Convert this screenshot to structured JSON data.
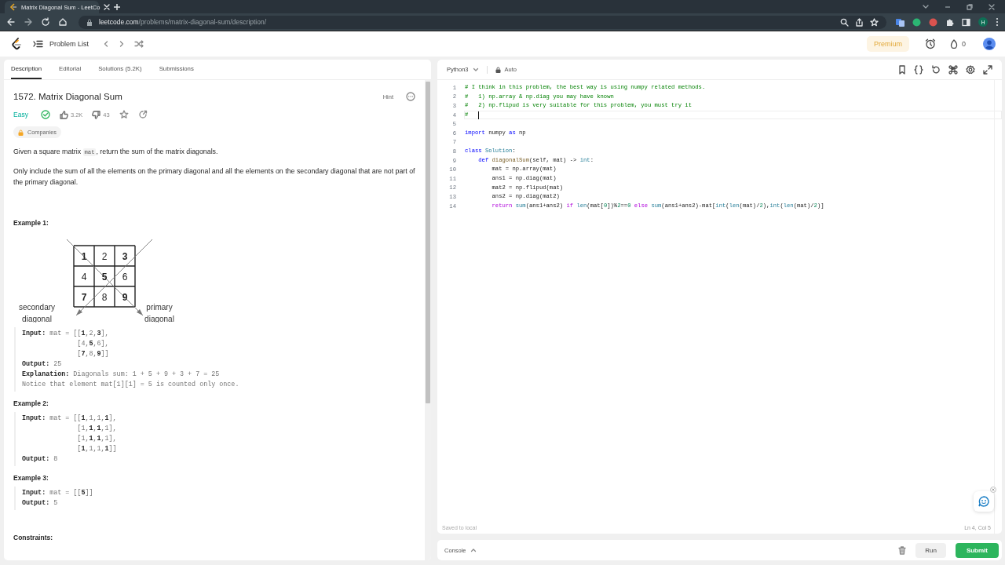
{
  "browser": {
    "tab_title": "Matrix Diagonal Sum - LeetCo",
    "url_host": "leetcode.com",
    "url_path": "/problems/matrix-diagonal-sum/description/",
    "profile_initial": "H"
  },
  "nav": {
    "problem_list": "Problem List",
    "premium": "Premium",
    "streak": "0"
  },
  "description": {
    "tabs": [
      {
        "label": "Description",
        "selected": true
      },
      {
        "label": "Editorial",
        "selected": false
      },
      {
        "label": "Solutions (5.2K)",
        "selected": false
      },
      {
        "label": "Submissions",
        "selected": false
      }
    ],
    "title": "1572. Matrix Diagonal Sum",
    "hint": "Hint",
    "difficulty": "Easy",
    "solved": true,
    "likes": "3.2K",
    "dislikes": "43",
    "companies": "Companies",
    "paragraphs": [
      [
        {
          "text": "Given a square matrix "
        },
        {
          "text": "mat",
          "kind": "code"
        },
        {
          "text": ", return the sum of the matrix diagonals."
        }
      ],
      [
        {
          "text": "Only include the sum of all the elements on the primary diagonal and all the elements on the secondary diagonal that are not part of the primary diagonal."
        }
      ]
    ],
    "examples": [
      {
        "heading": "Example 1:",
        "diagram": {
          "cells": [
            {
              "text": "1",
              "bold": true
            },
            {
              "text": "2",
              "bold": false
            },
            {
              "text": "3",
              "bold": true
            },
            {
              "text": "4",
              "bold": false
            },
            {
              "text": "5",
              "bold": true
            },
            {
              "text": "6",
              "bold": false
            },
            {
              "text": "7",
              "bold": true
            },
            {
              "text": "8",
              "bold": false
            },
            {
              "text": "9",
              "bold": true
            }
          ],
          "secondary_label": [
            "secondary",
            "diagonal"
          ],
          "primary_label": [
            "primary",
            "diagonal"
          ]
        },
        "lines": [
          "**Input:** mat = [[**1**,2,**3**],",
          "              [4,**5**,6],",
          "              [**7**,8,**9**]]",
          "**Output:** 25",
          "**Explanation:** Diagonals sum: 1 + 5 + 9 + 3 + 7 = 25",
          "Notice that element mat[1][1] = 5 is counted only once."
        ]
      },
      {
        "heading": "Example 2:",
        "lines": [
          "**Input:** mat = [[**1**,1,1,**1**],",
          "              [1,**1**,**1**,1],",
          "              [1,**1**,**1**,1],",
          "              [**1**,1,1,**1**]]",
          "**Output:** 8"
        ]
      },
      {
        "heading": "Example 3:",
        "lines": [
          "**Input:** mat = [[**5**]]",
          "**Output:** 5"
        ]
      }
    ],
    "constraints_heading": "Constraints:"
  },
  "editor": {
    "language": "Python3",
    "mode": "Auto",
    "lines": [
      {
        "no": "1",
        "current": false,
        "tokens": [
          {
            "t": "# I think in this problem, the best way is using numpy related methods.",
            "kind": "comment"
          }
        ]
      },
      {
        "no": "2",
        "current": false,
        "tokens": [
          {
            "t": "#   1) np.array & np.diag you may have known",
            "kind": "comment"
          }
        ]
      },
      {
        "no": "3",
        "current": false,
        "tokens": [
          {
            "t": "#   2) np.flipud is very suitable for this problem, you must try it",
            "kind": "comment"
          }
        ]
      },
      {
        "no": "4",
        "current": true,
        "tokens": [
          {
            "t": "#   ",
            "kind": "comment"
          }
        ]
      },
      {
        "no": "5",
        "current": false
      },
      {
        "no": "6",
        "current": false,
        "tokens": [
          {
            "t": "import",
            "kind": "keyword"
          },
          {
            "t": " numpy ",
            "kind": "plain"
          },
          {
            "t": "as",
            "kind": "keyword"
          },
          {
            "t": " np",
            "kind": "plain"
          }
        ]
      },
      {
        "no": "7",
        "current": false
      },
      {
        "no": "8",
        "current": false,
        "tokens": [
          {
            "t": "class",
            "kind": "keyword"
          },
          {
            "t": " Solution",
            "kind": "class"
          },
          {
            "t": ":",
            "kind": "plain"
          }
        ]
      },
      {
        "no": "9",
        "current": false,
        "tokens": [
          {
            "t": "    def",
            "kind": "keyword"
          },
          {
            "t": " diagonalSum",
            "kind": "function"
          },
          {
            "t": "(self, mat) -> ",
            "kind": "plain"
          },
          {
            "t": "int",
            "kind": "builtin"
          },
          {
            "t": ":",
            "kind": "plain"
          }
        ]
      },
      {
        "no": "10",
        "current": false,
        "tokens": [
          {
            "t": "        mat = np.array(mat)",
            "kind": "plain"
          }
        ]
      },
      {
        "no": "11",
        "current": false,
        "tokens": [
          {
            "t": "        ans1 = np.diag(mat)",
            "kind": "plain"
          }
        ]
      },
      {
        "no": "12",
        "current": false,
        "tokens": [
          {
            "t": "        mat2 = np.flipud(mat)",
            "kind": "plain"
          }
        ]
      },
      {
        "no": "13",
        "current": false,
        "tokens": [
          {
            "t": "        ans2 = np.diag(mat2)",
            "kind": "plain"
          }
        ]
      },
      {
        "no": "14",
        "current": false,
        "tokens": [
          {
            "t": "        return",
            "kind": "control"
          },
          {
            "t": " sum",
            "kind": "builtin"
          },
          {
            "t": "(ans1+ans2) ",
            "kind": "plain"
          },
          {
            "t": "if",
            "kind": "control"
          },
          {
            "t": " len",
            "kind": "builtin"
          },
          {
            "t": "(mat[",
            "kind": "plain"
          },
          {
            "t": "0",
            "kind": "number"
          },
          {
            "t": "])%",
            "kind": "plain"
          },
          {
            "t": "2",
            "kind": "number"
          },
          {
            "t": "==",
            "kind": "plain"
          },
          {
            "t": "0",
            "kind": "number"
          },
          {
            "t": " else",
            "kind": "control"
          },
          {
            "t": " sum",
            "kind": "builtin"
          },
          {
            "t": "(ans1+ans2)-mat[",
            "kind": "plain"
          },
          {
            "t": "int",
            "kind": "builtin"
          },
          {
            "t": "(",
            "kind": "plain"
          },
          {
            "t": "len",
            "kind": "builtin"
          },
          {
            "t": "(mat)/",
            "kind": "plain"
          },
          {
            "t": "2",
            "kind": "number"
          },
          {
            "t": "),",
            "kind": "plain"
          },
          {
            "t": "int",
            "kind": "builtin"
          },
          {
            "t": "(",
            "kind": "plain"
          },
          {
            "t": "len",
            "kind": "builtin"
          },
          {
            "t": "(mat)/",
            "kind": "plain"
          },
          {
            "t": "2",
            "kind": "number"
          },
          {
            "t": ")]",
            "kind": "plain"
          }
        ]
      }
    ],
    "saved": "Saved to local",
    "position": "Ln 4, Col 5",
    "console": "Console",
    "run": "Run",
    "submit": "Submit"
  }
}
